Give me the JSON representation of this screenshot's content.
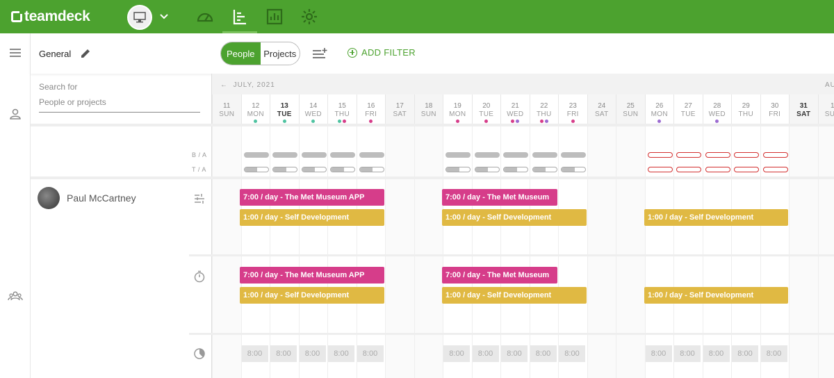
{
  "app": {
    "logo_text": "teamdeck",
    "brand_color": "#4ca22f"
  },
  "nav": {
    "icons": [
      "dashboard-icon",
      "scheduler-icon",
      "reports-icon",
      "settings-icon"
    ],
    "active": "scheduler-icon"
  },
  "toolbar": {
    "view_name": "General",
    "toggle_people": "People",
    "toggle_projects": "Projects",
    "add_filter": "ADD FILTER"
  },
  "search": {
    "label": "Search for",
    "placeholder": "People or projects"
  },
  "calendar": {
    "month_label": "JULY, 2021",
    "next_month_label": "AU",
    "days": [
      {
        "num": "11",
        "dow": "SUN",
        "weekend": true,
        "dots": []
      },
      {
        "num": "12",
        "dow": "MON",
        "dots": [
          "#4fc3a1"
        ]
      },
      {
        "num": "13",
        "dow": "TUE",
        "today": true,
        "dots": [
          "#4fc3a1"
        ]
      },
      {
        "num": "14",
        "dow": "WED",
        "dots": [
          "#4fc3a1"
        ]
      },
      {
        "num": "15",
        "dow": "THU",
        "dots": [
          "#4fc3a1",
          "#d63d8a"
        ]
      },
      {
        "num": "16",
        "dow": "FRI",
        "dots": [
          "#d63d8a"
        ]
      },
      {
        "num": "17",
        "dow": "SAT",
        "weekend": true,
        "dots": []
      },
      {
        "num": "18",
        "dow": "SUN",
        "weekend": true,
        "dots": []
      },
      {
        "num": "19",
        "dow": "MON",
        "dots": [
          "#d63d8a"
        ]
      },
      {
        "num": "20",
        "dow": "TUE",
        "dots": [
          "#d63d8a"
        ]
      },
      {
        "num": "21",
        "dow": "WED",
        "dots": [
          "#d63d8a",
          "#9c6bd1"
        ]
      },
      {
        "num": "22",
        "dow": "THU",
        "dots": [
          "#d63d8a",
          "#9c6bd1"
        ]
      },
      {
        "num": "23",
        "dow": "FRI",
        "dots": [
          "#d63d8a"
        ]
      },
      {
        "num": "24",
        "dow": "SAT",
        "weekend": true,
        "dots": []
      },
      {
        "num": "25",
        "dow": "SUN",
        "weekend": true,
        "dots": []
      },
      {
        "num": "26",
        "dow": "MON",
        "dots": [
          "#9c6bd1"
        ]
      },
      {
        "num": "27",
        "dow": "TUE",
        "dots": []
      },
      {
        "num": "28",
        "dow": "WED",
        "dots": [
          "#9c6bd1"
        ]
      },
      {
        "num": "29",
        "dow": "THU",
        "dots": []
      },
      {
        "num": "30",
        "dow": "FRI",
        "dots": []
      },
      {
        "num": "31",
        "dow": "SAT",
        "weekend": true,
        "today": true,
        "dots": []
      },
      {
        "num": "1",
        "dow": "SUN",
        "weekend": true,
        "dots": []
      }
    ]
  },
  "capacity": {
    "ba_label": "B / A",
    "ta_label": "T / A"
  },
  "person": {
    "name": "Paul McCartney",
    "bookings": [
      {
        "text": "7:00 / day - The Met Museum APP",
        "color": "pink"
      },
      {
        "text": "7:00 / day - The Met Museum",
        "color": "pink"
      },
      {
        "text": "1:00 / day - Self Development",
        "color": "yellow"
      },
      {
        "text": "1:00 / day - Self Development",
        "color": "yellow"
      },
      {
        "text": "1:00 / day - Self Development",
        "color": "yellow"
      }
    ],
    "timesheets": [
      {
        "text": "7:00 / day - The Met Museum APP",
        "color": "pink"
      },
      {
        "text": "7:00 / day - The Met Museum",
        "color": "pink"
      },
      {
        "text": "1:00 / day - Self Development",
        "color": "yellow"
      },
      {
        "text": "1:00 / day - Self Development",
        "color": "yellow"
      },
      {
        "text": "1:00 / day - Self Development",
        "color": "yellow"
      }
    ],
    "availability": [
      "8:00",
      "8:00",
      "8:00",
      "8:00",
      "8:00",
      "8:00",
      "8:00",
      "8:00",
      "8:00",
      "8:00",
      "8:00",
      "8:00",
      "8:00",
      "8:00",
      "8:00"
    ]
  }
}
